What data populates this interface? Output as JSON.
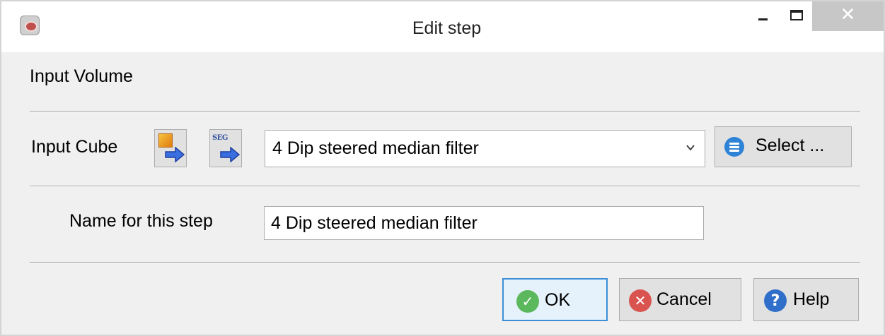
{
  "window": {
    "title": "Edit step",
    "close_glyph": "✕"
  },
  "section": {
    "title": "Input Volume"
  },
  "input_cube": {
    "label": "Input Cube",
    "selected": "4 Dip steered median filter",
    "import_icon": "import-volume-icon",
    "segy_icon": "segy-import-icon",
    "segy_text": "SEG",
    "select_label": "Select ..."
  },
  "step": {
    "label": "Name for this step",
    "value": "4 Dip steered median filter"
  },
  "buttons": {
    "ok": "OK",
    "cancel": "Cancel",
    "help": "Help",
    "ok_glyph": "✓",
    "cancel_glyph": "✕",
    "help_glyph": "?"
  },
  "colors": {
    "accent": "#3c8fd6",
    "ok_green": "#5cb85c",
    "cancel_red": "#d9534f",
    "help_blue": "#2f6fca"
  }
}
